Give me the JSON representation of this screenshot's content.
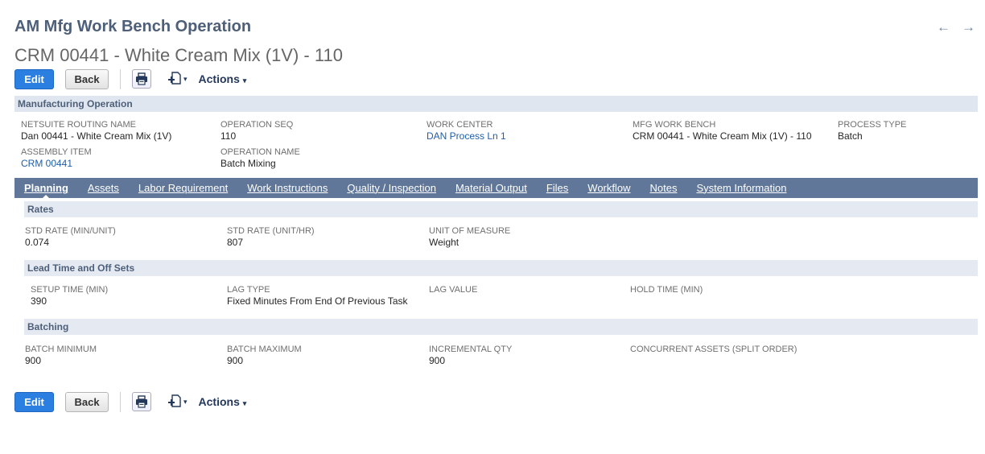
{
  "header": {
    "page_title": "AM Mfg Work Bench Operation",
    "record_title": "CRM 00441 - White Cream Mix (1V) - 110",
    "prev_icon": "←",
    "next_icon": "→"
  },
  "toolbar": {
    "edit_label": "Edit",
    "back_label": "Back",
    "actions_label": "Actions",
    "caret": "▾"
  },
  "main_section": {
    "title": "Manufacturing Operation",
    "fields": {
      "routing_name": {
        "label": "NETSUITE ROUTING NAME",
        "value": "Dan 00441 - White Cream Mix (1V)"
      },
      "operation_seq": {
        "label": "OPERATION SEQ",
        "value": "110"
      },
      "work_center": {
        "label": "WORK CENTER",
        "value": "DAN Process Ln 1"
      },
      "mfg_work_bench": {
        "label": "MFG WORK BENCH",
        "value": "CRM 00441 - White Cream Mix (1V) - 110"
      },
      "process_type": {
        "label": "PROCESS TYPE",
        "value": "Batch"
      },
      "assembly_item": {
        "label": "ASSEMBLY ITEM",
        "value": "CRM 00441"
      },
      "operation_name": {
        "label": "OPERATION NAME",
        "value": "Batch Mixing"
      }
    }
  },
  "tabs": [
    {
      "label": "Planning",
      "active": true
    },
    {
      "label": "Assets"
    },
    {
      "label": "Labor Requirement"
    },
    {
      "label": "Work Instructions"
    },
    {
      "label": "Quality / Inspection"
    },
    {
      "label": "Material Output"
    },
    {
      "label": "Files"
    },
    {
      "label": "Workflow"
    },
    {
      "label": "Notes"
    },
    {
      "label": "System Information"
    }
  ],
  "planning": {
    "rates": {
      "title": "Rates",
      "std_rate_min_unit": {
        "label": "STD RATE (MIN/UNIT)",
        "value": "0.074"
      },
      "std_rate_unit_hr": {
        "label": "STD RATE (UNIT/HR)",
        "value": "807"
      },
      "unit_of_measure": {
        "label": "UNIT OF MEASURE",
        "value": "Weight"
      }
    },
    "lead_time": {
      "title": "Lead Time and Off Sets",
      "setup_time": {
        "label": "SETUP TIME (MIN)",
        "value": "390"
      },
      "lag_type": {
        "label": "LAG TYPE",
        "value": "Fixed Minutes From End Of Previous Task"
      },
      "lag_value": {
        "label": "LAG VALUE",
        "value": ""
      },
      "hold_time": {
        "label": "HOLD TIME (MIN)",
        "value": ""
      }
    },
    "batching": {
      "title": "Batching",
      "batch_minimum": {
        "label": "BATCH MINIMUM",
        "value": "900"
      },
      "batch_maximum": {
        "label": "BATCH MAXIMUM",
        "value": "900"
      },
      "incremental_qty": {
        "label": "INCREMENTAL QTY",
        "value": "900"
      },
      "concurrent_assets": {
        "label": "CONCURRENT ASSETS (SPLIT ORDER)",
        "value": ""
      }
    }
  },
  "colors": {
    "accent": "#2a7fe0",
    "tab_bar": "#607799",
    "section_bar": "#e0e6ef",
    "title": "#4d5f79",
    "link": "#1f5ea8"
  }
}
